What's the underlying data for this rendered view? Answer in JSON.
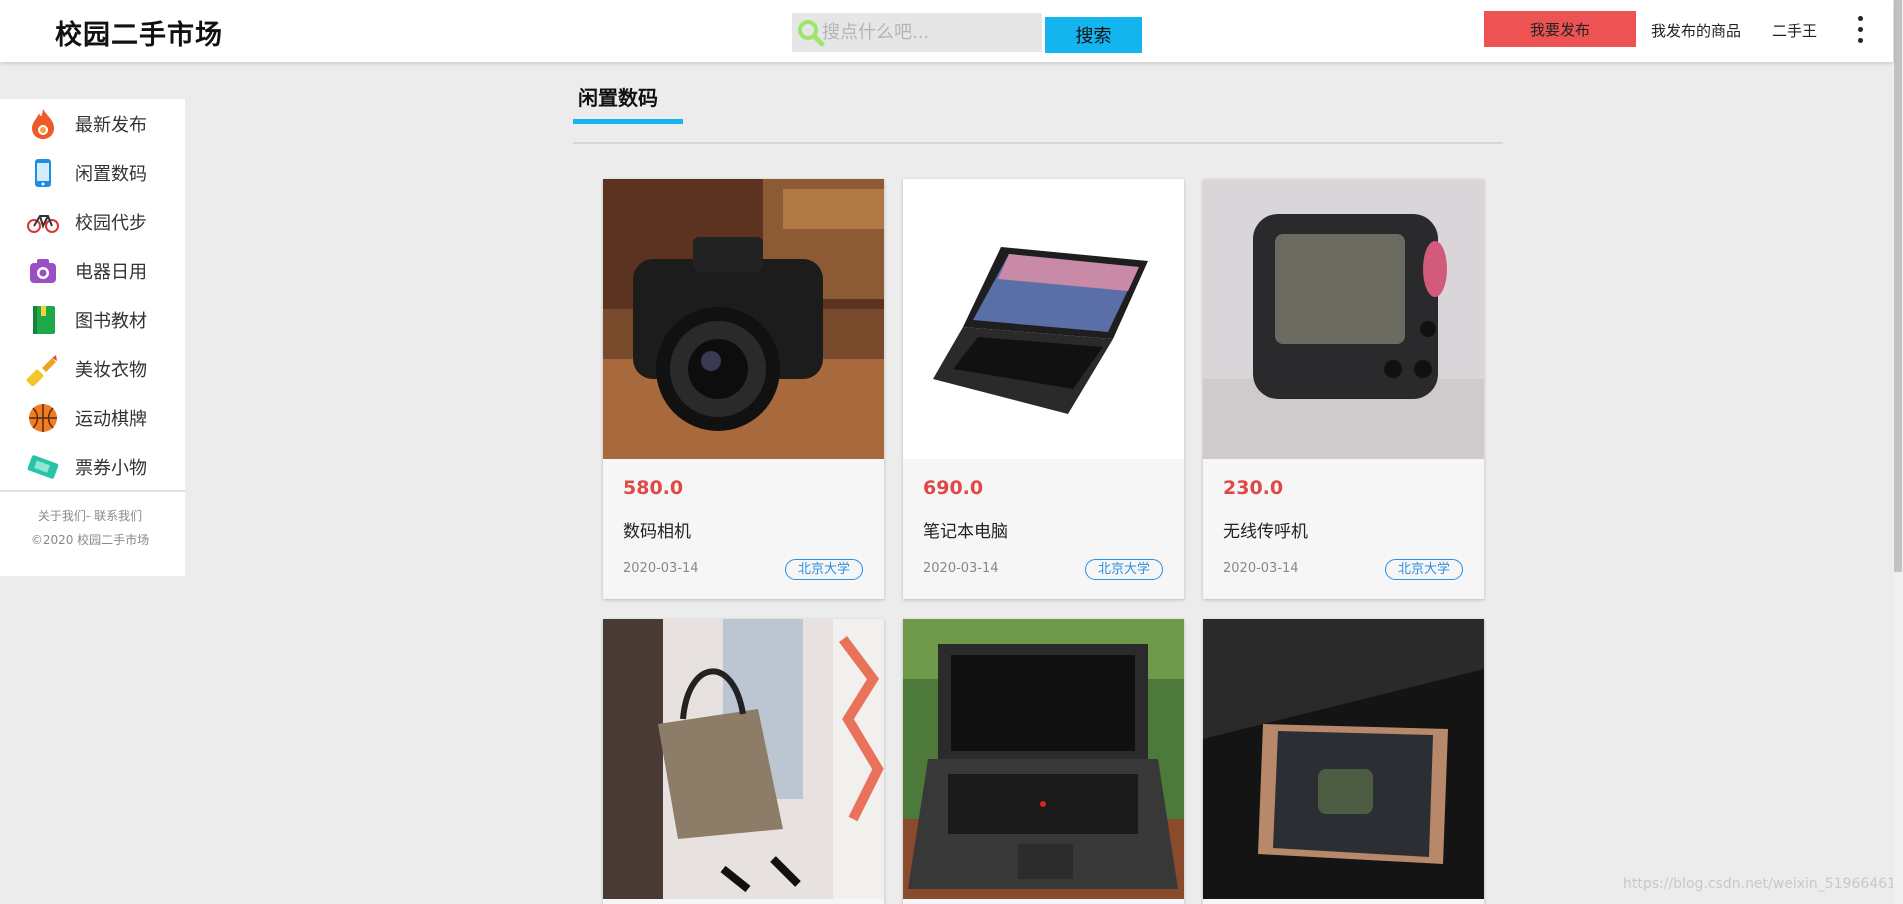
{
  "header": {
    "logo": "校园二手市场",
    "search_placeholder": "搜点什么吧...",
    "search_button": "搜索",
    "publish_button": "我要发布",
    "my_goods": "我发布的商品",
    "username": "二手王"
  },
  "sidebar": {
    "items": [
      {
        "label": "最新发布",
        "icon": "fire-icon"
      },
      {
        "label": "闲置数码",
        "icon": "phone-icon"
      },
      {
        "label": "校园代步",
        "icon": "bicycle-icon"
      },
      {
        "label": "电器日用",
        "icon": "camera-icon"
      },
      {
        "label": "图书教材",
        "icon": "book-icon"
      },
      {
        "label": "美妆衣物",
        "icon": "lipstick-icon"
      },
      {
        "label": "运动棋牌",
        "icon": "basketball-icon"
      },
      {
        "label": "票券小物",
        "icon": "ticket-icon"
      }
    ],
    "footer_links": "关于我们- 联系我们",
    "copyright": "©2020 校园二手市场"
  },
  "main": {
    "category_title": "闲置数码",
    "products": [
      {
        "price": "580.0",
        "title": "数码相机",
        "date": "2020-03-14",
        "school": "北京大学",
        "image": "camera-photo"
      },
      {
        "price": "690.0",
        "title": "笔记本电脑",
        "date": "2020-03-14",
        "school": "北京大学",
        "image": "laptop-photo"
      },
      {
        "price": "230.0",
        "title": "无线传呼机",
        "date": "2020-03-14",
        "school": "北京大学",
        "image": "pager-photo"
      },
      {
        "image": "handbag-photo"
      },
      {
        "image": "thinkpad-photo"
      },
      {
        "image": "smartphone-photo"
      }
    ]
  },
  "watermark": "https://blog.csdn.net/weixin_51966461",
  "colors": {
    "accent": "#14b4ef",
    "publish": "#ee5353",
    "price": "#e04848",
    "tag": "#2e8fe0"
  }
}
